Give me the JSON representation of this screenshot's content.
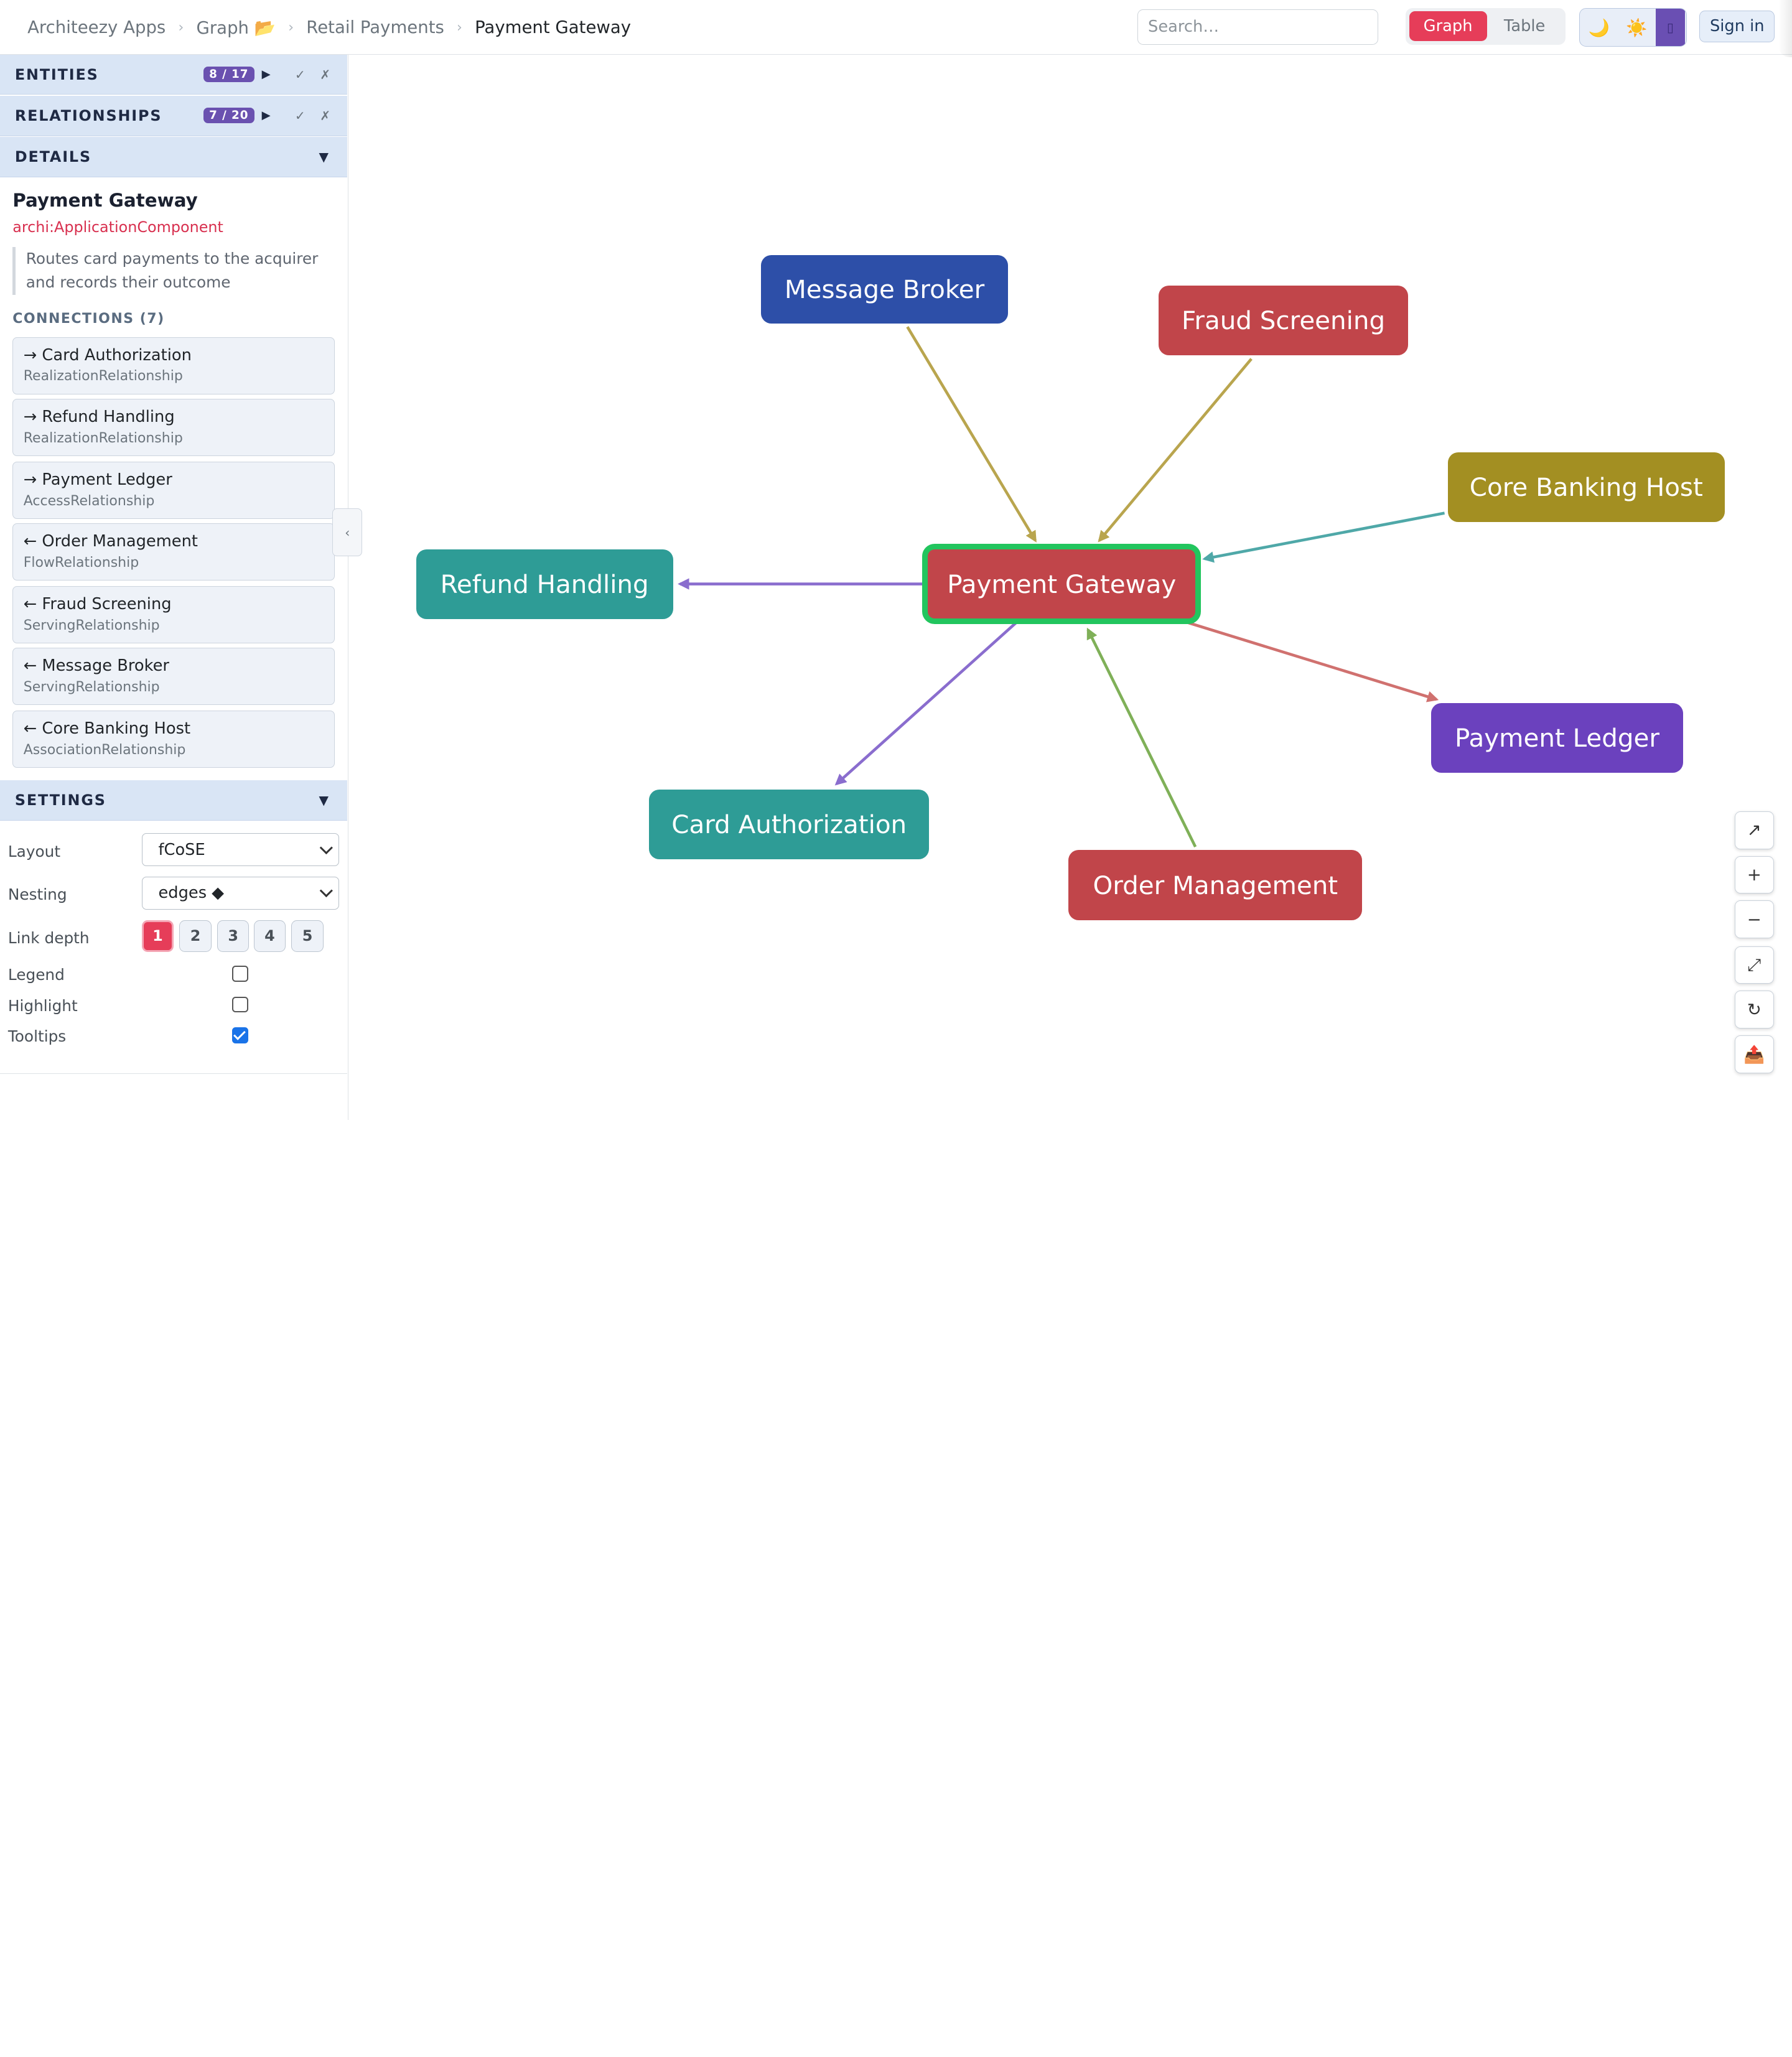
{
  "breadcrumb": {
    "items": [
      "Architeezy Apps",
      "Graph 📂",
      "Retail Payments"
    ],
    "current": "Payment Gateway",
    "separator": "›"
  },
  "search": {
    "placeholder": "Search…"
  },
  "view_toggle": {
    "graph": "Graph",
    "table": "Table",
    "active": "Graph"
  },
  "theme": {
    "moon": "🌙",
    "sun": "☀️",
    "system": "▯"
  },
  "signin": "Sign in",
  "sections": {
    "entities": {
      "title": "ENTITIES",
      "badge": "8 / 17",
      "play": "▶",
      "check": "✓",
      "cross": "✗"
    },
    "relationships": {
      "title": "RELATIONSHIPS",
      "badge": "7 / 20",
      "play": "▶",
      "check": "✓",
      "cross": "✗"
    },
    "details": {
      "title": "DETAILS",
      "caret": "▼"
    },
    "settings": {
      "title": "SETTINGS",
      "caret": "▼"
    }
  },
  "details": {
    "name": "Payment Gateway",
    "type": "archi:ApplicationComponent",
    "description": "Routes card payments to the acquirer and records their outcome",
    "connections_title": "CONNECTIONS (7)",
    "connections": [
      {
        "label": "→ Card Authorization",
        "relation": "RealizationRelationship"
      },
      {
        "label": "→ Refund Handling",
        "relation": "RealizationRelationship"
      },
      {
        "label": "→ Payment Ledger",
        "relation": "AccessRelationship"
      },
      {
        "label": "← Order Management",
        "relation": "FlowRelationship"
      },
      {
        "label": "← Fraud Screening",
        "relation": "ServingRelationship"
      },
      {
        "label": "← Message Broker",
        "relation": "ServingRelationship"
      },
      {
        "label": "← Core Banking Host",
        "relation": "AssociationRelationship"
      }
    ],
    "collapse": "‹"
  },
  "settings": {
    "layout_label": "Layout",
    "layout_value": "fCoSE",
    "nesting_label": "Nesting",
    "nesting_value": "edges ◆",
    "link_depth_label": "Link depth",
    "link_depth_options": [
      "1",
      "2",
      "3",
      "4",
      "5"
    ],
    "link_depth_selected": "1",
    "legend_label": "Legend",
    "legend_checked": false,
    "highlight_label": "Highlight",
    "highlight_checked": false,
    "tooltips_label": "Tooltips",
    "tooltips_checked": true
  },
  "graph": {
    "nodes": {
      "message_broker": {
        "label": "Message Broker",
        "color": "#2d4fa8"
      },
      "fraud_screening": {
        "label": "Fraud Screening",
        "color": "#c1454a"
      },
      "core_banking_host": {
        "label": "Core Banking Host",
        "color": "#a38f22"
      },
      "refund_handling": {
        "label": "Refund Handling",
        "color": "#2e9c96"
      },
      "payment_gateway": {
        "label": "Payment Gateway",
        "color": "#c1454a"
      },
      "payment_ledger": {
        "label": "Payment Ledger",
        "color": "#6b41be"
      },
      "card_authorization": {
        "label": "Card Authorization",
        "color": "#2e9c96"
      },
      "order_management": {
        "label": "Order Management",
        "color": "#c1454a"
      }
    },
    "selected_border_color": "#22c55e",
    "edge_colors": {
      "serving": "#b9a54e",
      "association": "#4fa8a8",
      "realization": "#8a6dce",
      "access": "#d0716f",
      "flow": "#7fb058"
    }
  },
  "zoom_controls": [
    "↗",
    "+",
    "−",
    "⤢",
    "↻",
    "📤"
  ]
}
